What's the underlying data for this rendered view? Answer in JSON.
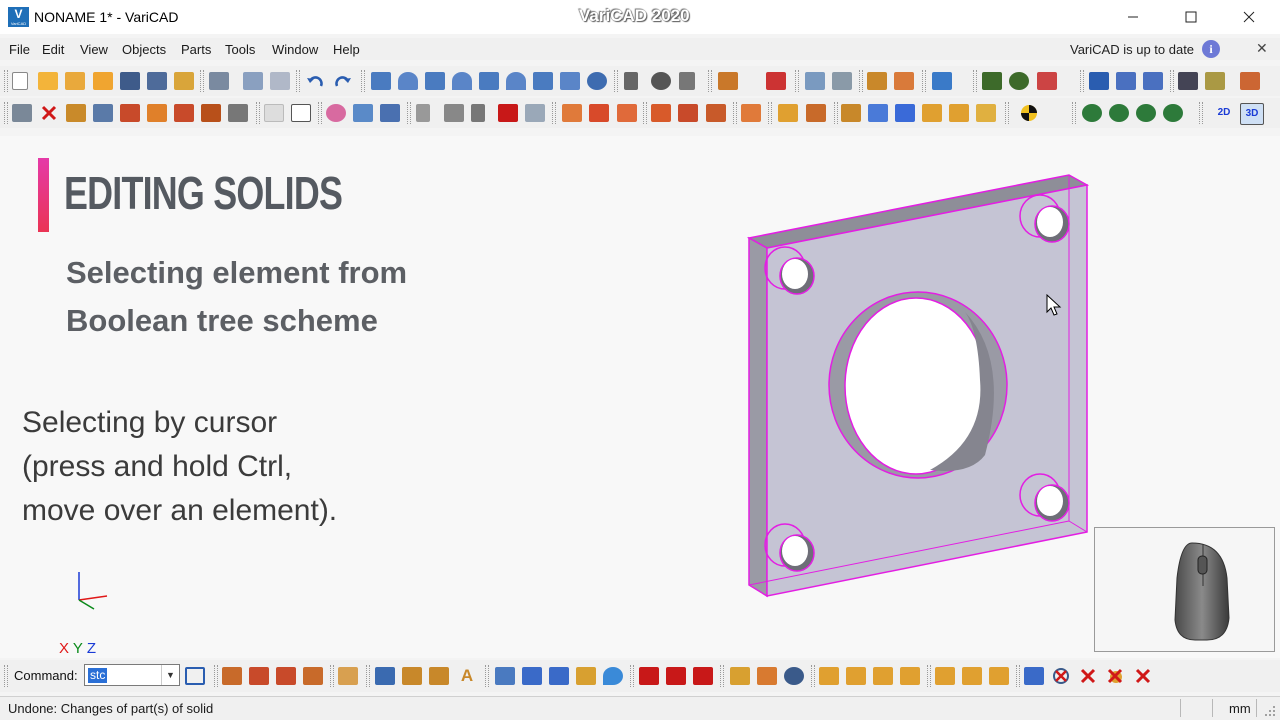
{
  "window": {
    "title": "NONAME 1* - VariCAD",
    "center_title": "VariCAD 2020",
    "logo_text": "V",
    "logo_subtext": "VariCAD"
  },
  "menu": [
    "File",
    "Edit",
    "View",
    "Objects",
    "Parts",
    "Tools",
    "Window",
    "Help"
  ],
  "notice": {
    "text": "VariCAD is up to date",
    "info_glyph": "i"
  },
  "slide": {
    "heading": "EDITING SOLIDS",
    "subtitle_line1": "Selecting element from",
    "subtitle_line2": "Boolean tree scheme",
    "body_line1": "Selecting by cursor",
    "body_line2": "(press and hold Ctrl,",
    "body_line3": "move over an element).",
    "accent_color": "#e53a8c"
  },
  "axes": {
    "x": "X",
    "y": "Y",
    "z": "Z"
  },
  "command": {
    "label": "Command:",
    "value": "stc"
  },
  "status": {
    "message": "Undone: Changes of part(s) of solid",
    "unit": "mm"
  },
  "toolbar_buttons": [
    "2D",
    "3D"
  ],
  "colors": {
    "highlight": "#e31ee3",
    "solid": "#c5c4d4",
    "accent": "#e53a8c"
  }
}
